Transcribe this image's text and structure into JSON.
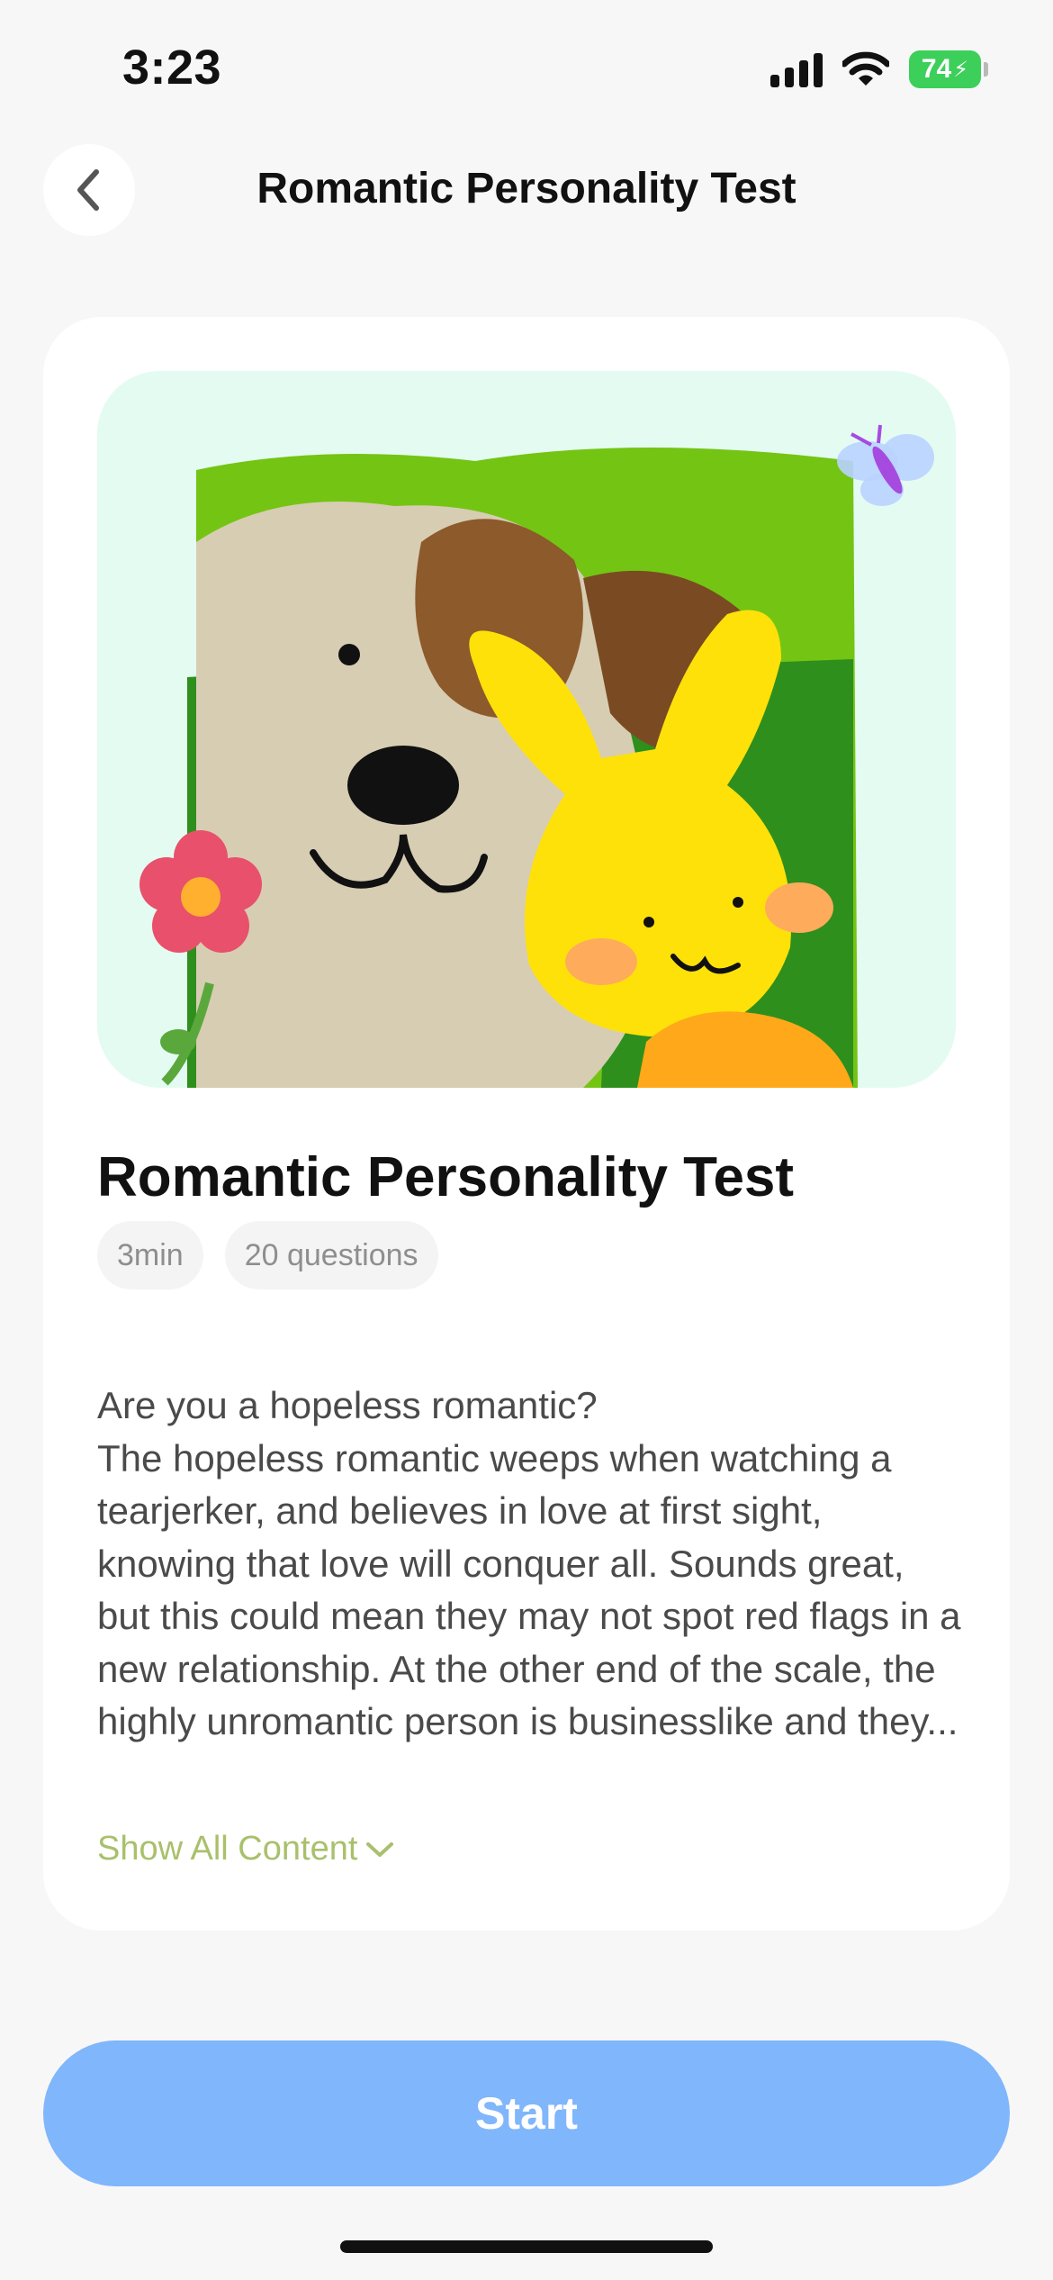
{
  "status_bar": {
    "time": "3:23",
    "battery": "74"
  },
  "header": {
    "title": "Romantic Personality Test"
  },
  "card": {
    "title": "Romantic Personality Test",
    "tags": [
      "3min",
      "20 questions"
    ],
    "description": "Are you a hopeless romantic?\nThe hopeless romantic weeps when watching a tearjerker, and believes in love at first sight, knowing that love will conquer all. Sounds great, but this could mean they may not spot red flags in a new relationship. At the other end of the scale, the highly unromantic person is businesslike and they...",
    "show_all_label": "Show All Content"
  },
  "start_button": {
    "label": "Start"
  },
  "colors": {
    "accent": "#80b6fb",
    "link": "#a9c06c",
    "battery": "#3ccf5a"
  },
  "icons": [
    "back-chevron-icon",
    "signal-icon",
    "wifi-icon",
    "battery-icon",
    "chevron-down-icon"
  ]
}
